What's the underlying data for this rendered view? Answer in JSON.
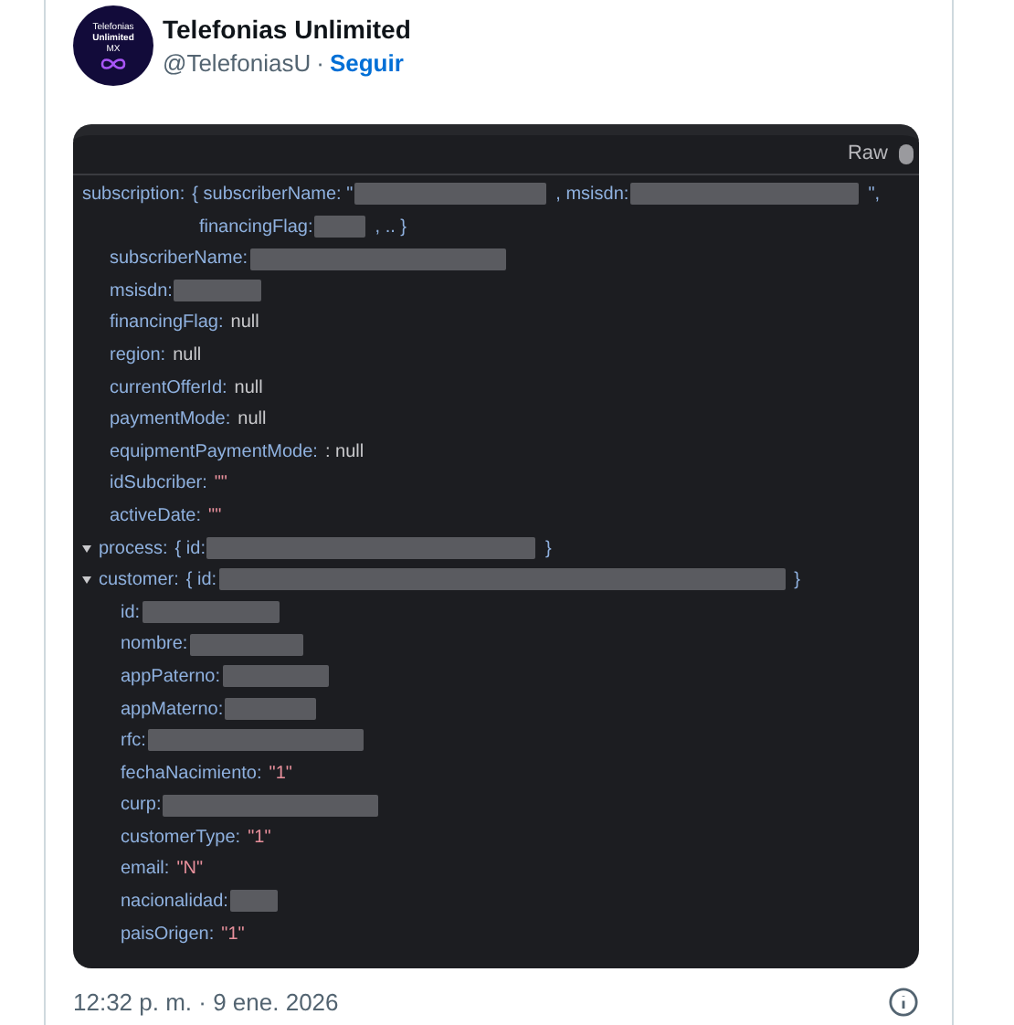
{
  "author": {
    "avatar_text": [
      "Telefonias",
      "Unlimited",
      "MX"
    ],
    "name": "Telefonias Unlimited",
    "handle": "@TelefoniasU",
    "separator": "·",
    "follow": "Seguir"
  },
  "inspector": {
    "toggle_label": "Raw",
    "properties": [
      {
        "key": "subscription:",
        "value": [
          {
            "kind": "punct",
            "text": "{ subscriberName: \""
          },
          {
            "kind": "redacted"
          },
          {
            "kind": "punct",
            "text": ", msisdn:"
          },
          {
            "kind": "redacted"
          },
          {
            "kind": "punct",
            "text": "\","
          },
          {
            "kind": "break"
          },
          {
            "kind": "punct",
            "text": "financingFlag:"
          },
          {
            "kind": "redacted"
          },
          {
            "kind": "punct",
            "text": ", .. }"
          }
        ],
        "children": [
          {
            "key": "subscriberName:",
            "value": [
              {
                "kind": "redacted"
              }
            ]
          },
          {
            "key": "msisdn:",
            "value": [
              {
                "kind": "redacted"
              }
            ]
          },
          {
            "key": "financingFlag:",
            "value": [
              {
                "kind": "null",
                "text": "null"
              }
            ]
          },
          {
            "key": "region:",
            "value": [
              {
                "kind": "null",
                "text": "null"
              }
            ]
          },
          {
            "key": "currentOfferId:",
            "value": [
              {
                "kind": "null",
                "text": "null"
              }
            ]
          },
          {
            "key": "paymentMode:",
            "value": [
              {
                "kind": "null",
                "text": "null"
              }
            ]
          },
          {
            "key": "equipmentPaymentMode:",
            "value": [
              {
                "kind": "null",
                "text": ": null"
              }
            ]
          },
          {
            "key": "idSubcriber:",
            "value": [
              {
                "kind": "string",
                "text": "\"\""
              }
            ]
          },
          {
            "key": "activeDate:",
            "value": [
              {
                "kind": "string",
                "text": "\"\""
              }
            ]
          }
        ]
      },
      {
        "key": "process:",
        "expanded": true,
        "value": [
          {
            "kind": "punct",
            "text": "{ id:"
          },
          {
            "kind": "redacted"
          },
          {
            "kind": "punct",
            "text": "}"
          }
        ]
      },
      {
        "key": "customer:",
        "expanded": true,
        "value": [
          {
            "kind": "punct",
            "text": "{ id:"
          },
          {
            "kind": "redacted"
          },
          {
            "kind": "punct",
            "text": "}"
          }
        ],
        "children": [
          {
            "key": "id:",
            "value": [
              {
                "kind": "redacted"
              }
            ]
          },
          {
            "key": "nombre:",
            "value": [
              {
                "kind": "redacted"
              }
            ]
          },
          {
            "key": "appPaterno:",
            "value": [
              {
                "kind": "redacted"
              }
            ]
          },
          {
            "key": "appMaterno:",
            "value": [
              {
                "kind": "redacted"
              }
            ]
          },
          {
            "key": "rfc:",
            "value": [
              {
                "kind": "redacted"
              }
            ]
          },
          {
            "key": "fechaNacimiento:",
            "value": [
              {
                "kind": "string",
                "text": "\"1\""
              }
            ]
          },
          {
            "key": "curp:",
            "value": [
              {
                "kind": "redacted"
              }
            ]
          },
          {
            "key": "customerType:",
            "value": [
              {
                "kind": "string",
                "text": "\"1\""
              }
            ]
          },
          {
            "key": "email:",
            "value": [
              {
                "kind": "string",
                "text": "\"N\""
              }
            ]
          },
          {
            "key": "nacionalidad:",
            "value": [
              {
                "kind": "redacted"
              }
            ]
          },
          {
            "key": "paisOrigen:",
            "value": [
              {
                "kind": "string",
                "text": "\"1\""
              }
            ]
          }
        ]
      }
    ]
  },
  "timestamp": "12:32 p. m. · 9 ene. 2026"
}
